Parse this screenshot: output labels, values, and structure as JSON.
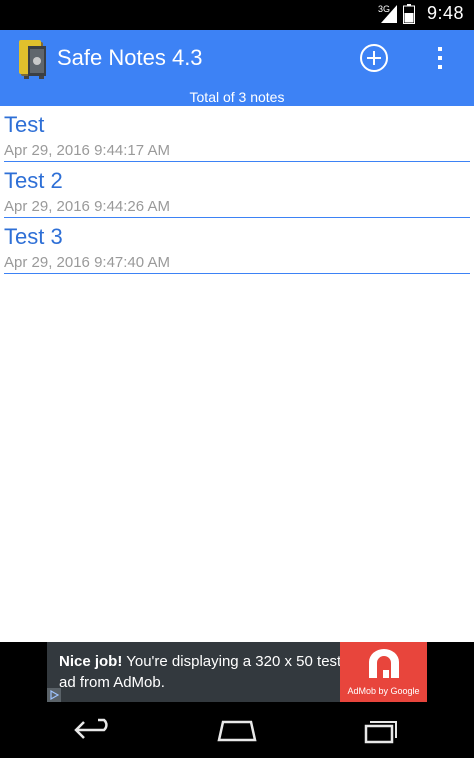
{
  "status_bar": {
    "network": "3G",
    "time": "9:48"
  },
  "action_bar": {
    "title": "Safe Notes 4.3",
    "app_icon": "safe-icon",
    "add_icon": "add-circle-icon",
    "overflow_icon": "overflow-menu-icon"
  },
  "summary": "Total of 3 notes",
  "notes": [
    {
      "title": "Test",
      "date": "Apr 29, 2016 9:44:17 AM"
    },
    {
      "title": "Test 2",
      "date": "Apr 29, 2016 9:44:26 AM"
    },
    {
      "title": "Test 3",
      "date": "Apr 29, 2016 9:47:40 AM"
    }
  ],
  "ad": {
    "headline": "Nice job!",
    "body": " You're displaying a 320 x 50 test ad from AdMob.",
    "logo_caption": "AdMob by Google"
  },
  "nav": {
    "back_icon": "back-icon",
    "home_icon": "home-icon",
    "recents_icon": "recents-icon"
  },
  "colors": {
    "accent": "#3d82f5",
    "note_title": "#2e6fd6",
    "note_date": "#9a9a9a",
    "ad_logo": "#e8453c"
  }
}
